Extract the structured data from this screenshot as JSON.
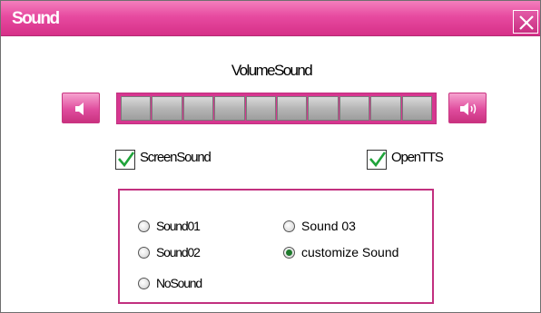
{
  "window": {
    "title": "Sound"
  },
  "volume": {
    "label": "VolumeSound",
    "segments_total": 10,
    "colors": {
      "accent": "#d63790",
      "segment": "#b5b5b5"
    }
  },
  "options": {
    "screen_sound": {
      "label": "ScreenSound",
      "checked": true
    },
    "open_tts": {
      "label": "OpenTTS",
      "checked": true
    }
  },
  "sounds": {
    "items": [
      {
        "label": "Sound01",
        "selected": false
      },
      {
        "label": "Sound02",
        "selected": false
      },
      {
        "label": "NoSound",
        "selected": false
      },
      {
        "label": "Sound 03",
        "selected": false
      },
      {
        "label": "customize Sound",
        "selected": true
      }
    ]
  },
  "icons": {
    "close": "close-icon",
    "volume_down": "speaker-low-icon",
    "volume_up": "speaker-high-icon",
    "check": "checkmark-icon"
  }
}
